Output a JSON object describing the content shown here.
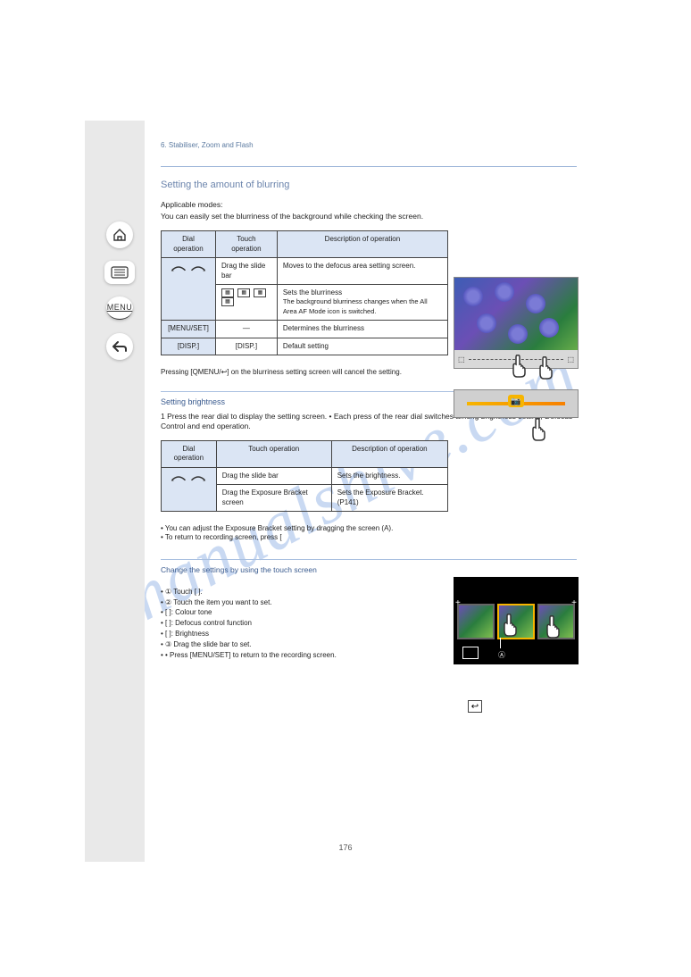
{
  "breadcrumb_text": "6. Stabiliser, Zoom and Flash",
  "nav": {
    "menu_label": "MENU"
  },
  "sec1": {
    "title": "Setting the amount of blurring",
    "sub1": "Applicable modes:",
    "sub2": "",
    "lead": "You can easily set the blurriness of the background while checking the screen.",
    "table": {
      "h1": "Dial operation",
      "h2": "Touch operation",
      "h3": "Description of operation",
      "rows": [
        {
          "c1_dial": true,
          "c2": "Drag the slide bar",
          "c3": "Moves to the defocus area setting screen."
        },
        {
          "c1": "—",
          "c2_modeboxes": true,
          "c3_a": "Sets the blurriness",
          "c3_b": "The background blurriness changes when the All Area AF Mode icon is switched."
        },
        {
          "c1": "[MENU/SET]",
          "c2": "—",
          "c3": "Determines the blurriness"
        },
        {
          "c1": "[DISP.]",
          "c2": "[DISP.]",
          "c3": "Default setting"
        }
      ],
      "footnote": "Pressing [QMENU/↩] on the blurriness setting screen will cancel the setting."
    }
  },
  "sec2": {
    "title": "Setting brightness",
    "body": "1 Press the rear dial to display the setting screen.\n• Each press of the rear dial switches among brightness setting, Defocus Control and end operation.",
    "table": {
      "h1": "Dial operation",
      "h2": "Touch operation",
      "h3": "Description of operation",
      "rows": [
        {
          "c1_dial": true,
          "c2": "Drag the slide bar",
          "c3": "Sets the brightness."
        },
        {
          "c1": "—",
          "c2": "Drag the Exposure Bracket screen",
          "c3": "Sets the Exposure Bracket. (P141)"
        }
      ]
    },
    "below": {
      "text": "• You can adjust the Exposure Bracket setting by dragging the screen (",
      "label_A": "A",
      "text2": ").",
      "ret_instr": "• To return to recording screen, press [",
      "ret_instr2": "]."
    }
  },
  "notes_title": "Change the settings by using the touch screen",
  "notes": [
    "① Touch [    ].",
    "② Touch the item you want to set.",
    "[    ]: Colour tone",
    "[    ]: Defocus control function",
    "[    ]: Brightness",
    "③ Drag the slide bar to set.",
    "• Press [MENU/SET] to return to the recording screen."
  ],
  "pagenum": "176"
}
